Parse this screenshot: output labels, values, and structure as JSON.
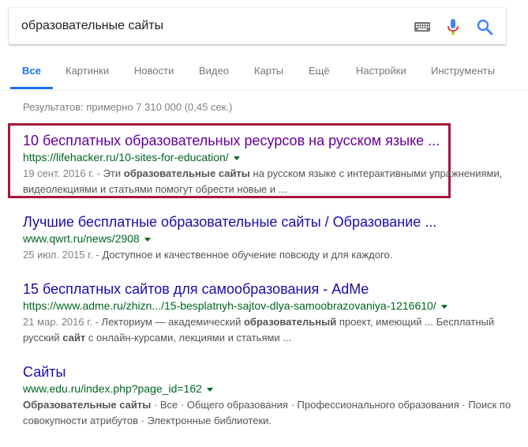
{
  "search": {
    "query": "образовательные сайты",
    "icons": [
      "keyboard-icon",
      "microphone-icon",
      "search-icon"
    ],
    "colors": {
      "mic_blue": "#4285f4",
      "mic_red": "#ea4335",
      "search_blue": "#4285f4"
    }
  },
  "tabs": [
    {
      "label": "Все",
      "active": true
    },
    {
      "label": "Картинки"
    },
    {
      "label": "Новости"
    },
    {
      "label": "Видео"
    },
    {
      "label": "Карты"
    },
    {
      "label": "Ещё"
    },
    {
      "label": "Настройки"
    },
    {
      "label": "Инструменты"
    }
  ],
  "stats": "Результатов: примерно 7 310 000 (0,45 сек.)",
  "results": [
    {
      "title": "10 бесплатных образовательных ресурсов на русском языке ...",
      "url": "https://lifehacker.ru/10-sites-for-education/",
      "date": "19 сент. 2016 г. - ",
      "snippet_parts": [
        "Эти ",
        "образовательные сайты",
        " на русском языке с интерактивными упражнениями, видеолекциями и статьями помогут обрести новые и ..."
      ],
      "visited": true,
      "highlighted": true
    },
    {
      "title": "Лучшие бесплатные образовательные сайты / Образование ...",
      "url": "www.qwrt.ru/news/2908",
      "date": "25 июл. 2015 г. - ",
      "snippet_parts": [
        "Доступное и качественное обучение повсюду и для каждого."
      ],
      "visited": false
    },
    {
      "title": "15 бесплатных сайтов для самообразования - AdMe",
      "url": "https://www.adme.ru/zhizn.../15-besplatnyh-sajtov-dlya-samoobrazovaniya-1216610/",
      "date": "21 мар. 2016 г. - ",
      "snippet_parts": [
        "Лекториум — академический ",
        "образовательный",
        " проект, имеющий ... Бесплатный русский ",
        "сайт",
        " с онлайн-курсами, лекциями и статьями ..."
      ],
      "visited": false
    },
    {
      "title": "Сайты",
      "url": "www.edu.ru/index.php?page_id=162",
      "date": "",
      "snippet_parts": [
        "Образовательные сайты",
        " · Все · Общего образования · Профессионального образования · Поиск по совокупности атрибутов · Электронные библиотеки."
      ],
      "visited": false
    }
  ],
  "colors": {
    "link": "#1a0dab",
    "visited_link": "#660099",
    "url_green": "#006621",
    "highlight_border": "#a5193b",
    "active_tab": "#1a73e8"
  }
}
